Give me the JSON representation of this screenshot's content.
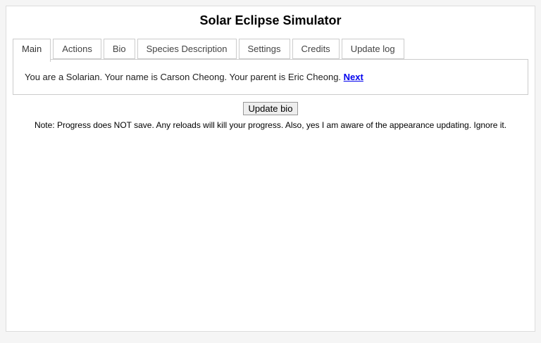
{
  "page": {
    "title": "Solar Eclipse Simulator"
  },
  "tabs": [
    {
      "label": "Main",
      "active": true
    },
    {
      "label": "Actions",
      "active": false
    },
    {
      "label": "Bio",
      "active": false
    },
    {
      "label": "Species Description",
      "active": false
    },
    {
      "label": "Settings",
      "active": false
    },
    {
      "label": "Credits",
      "active": false
    },
    {
      "label": "Update log",
      "active": false
    }
  ],
  "main": {
    "status_text": "You are a Solarian. Your name is Carson Cheong. Your parent is Eric Cheong.",
    "next_link": "Next",
    "update_bio_button": "Update bio",
    "note": "Note: Progress does NOT save. Any reloads will kill your progress. Also, yes I am aware of the appearance updating. Ignore it."
  },
  "colors": {
    "link": "#0000ee",
    "panel_border": "#cccccc",
    "card_border": "#dddddd",
    "page_background": "#f5f5f5"
  }
}
